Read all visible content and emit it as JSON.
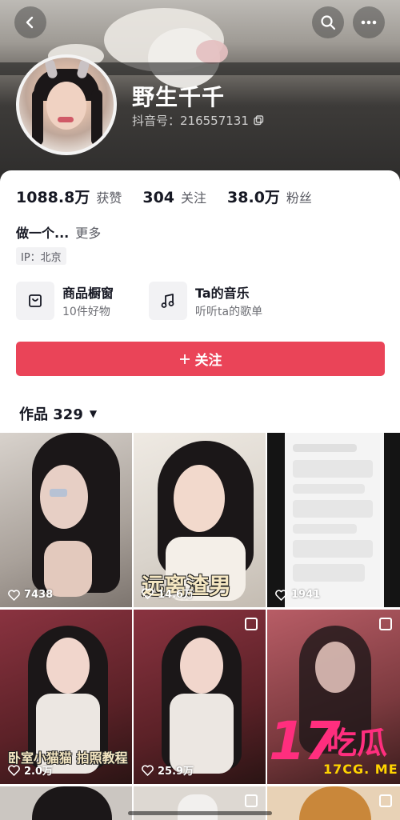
{
  "profile": {
    "nickname": "野生千千",
    "douyin_id": "抖音号：216557131"
  },
  "stats": [
    {
      "value": "1088.8万",
      "label": "获赞"
    },
    {
      "value": "304",
      "label": "关注"
    },
    {
      "value": "38.0万",
      "label": "粉丝"
    }
  ],
  "bio": {
    "text": "做一个...",
    "more": "更多"
  },
  "ip": "IP：北京",
  "features": [
    {
      "title": "商品橱窗",
      "subtitle": "10件好物",
      "icon": "bag-icon"
    },
    {
      "title": "Ta的音乐",
      "subtitle": "听听ta的歌单",
      "icon": "music-note-icon"
    }
  ],
  "follow_button": {
    "label": "关注",
    "icon": "plus-icon",
    "color": "#ea4458"
  },
  "works_tab": {
    "label": "作品 329",
    "icon": "caret-down-icon"
  },
  "videos": [
    {
      "likes": "7438",
      "overlay": ""
    },
    {
      "likes": "14.6万",
      "overlay": "远离渣男"
    },
    {
      "likes": "1941",
      "overlay": ""
    },
    {
      "likes": "2.0万",
      "overlay": "卧室小猫猫 拍照教程"
    },
    {
      "likes": "25.9万",
      "overlay": ""
    },
    {
      "likes": "",
      "overlay": ""
    }
  ],
  "watermark": {
    "brand": "17",
    "brand_cjk": "吃瓜",
    "site": "17CG. ME"
  }
}
